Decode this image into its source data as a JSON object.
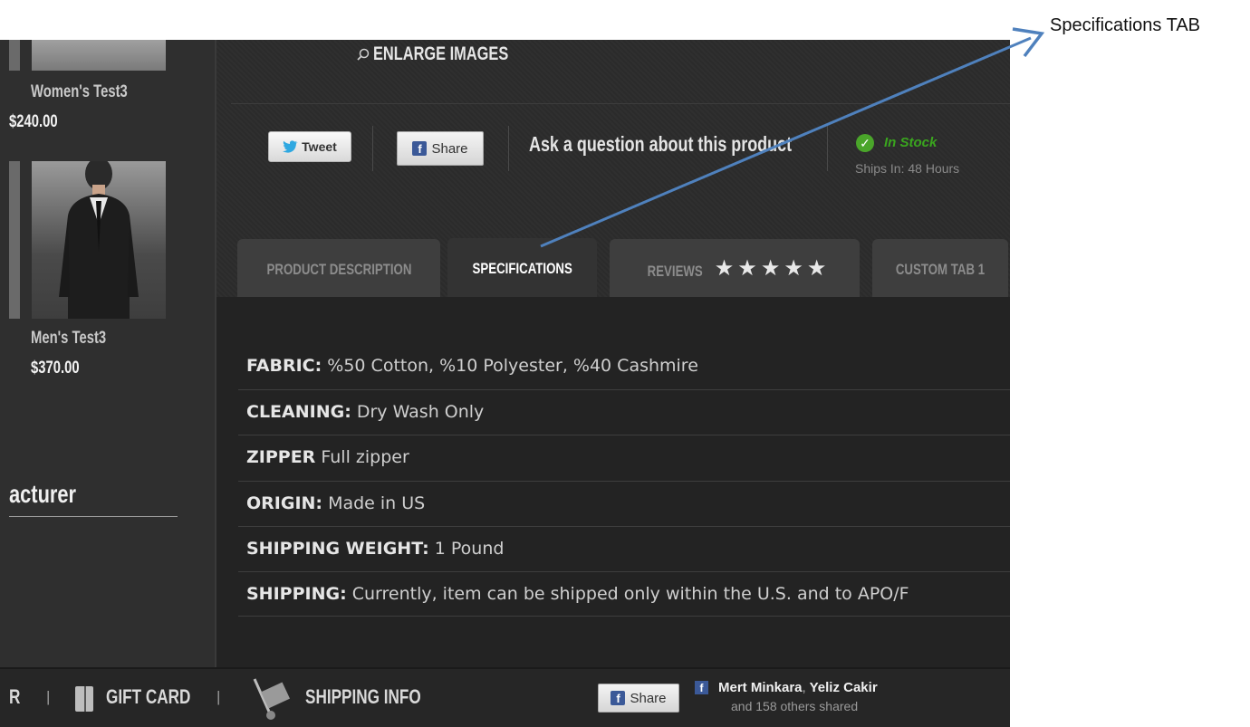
{
  "annotation": {
    "label": "Specifications TAB",
    "arrow_color": "#4f81bd"
  },
  "sidebar": {
    "products": [
      {
        "name": "Women's Test3",
        "price": "$240.00"
      },
      {
        "name": "Men's Test3",
        "price": "$370.00"
      }
    ],
    "manufacturer_heading": "acturer"
  },
  "product": {
    "enlarge_label": "ENLARGE IMAGES",
    "tweet_label": "Tweet",
    "share_label": "Share",
    "ask_label": "Ask a question about this product",
    "stock_status": "In Stock",
    "ships_in": "Ships In: 48 Hours"
  },
  "tabs": [
    {
      "label": "PRODUCT DESCRIPTION",
      "active": false
    },
    {
      "label": "SPECIFICATIONS",
      "active": true
    },
    {
      "label": "REVIEWS",
      "stars": "★★★★★",
      "rating": 5,
      "active": false
    },
    {
      "label": "CUSTOM TAB 1",
      "active": false
    }
  ],
  "specs": [
    {
      "key": "FABRIC:",
      "value": "%50 Cotton, %10 Polyester, %40 Cashmire"
    },
    {
      "key": "CLEANING:",
      "value": "Dry Wash Only"
    },
    {
      "key": "ZIPPER",
      "value": "Full zipper"
    },
    {
      "key": "ORIGIN:",
      "value": "Made in US"
    },
    {
      "key": "SHIPPING WEIGHT:",
      "value": "1 Pound"
    },
    {
      "key": "SHIPPING:",
      "value": "Currently, item can be shipped only within the U.S. and to APO/F"
    }
  ],
  "footer": {
    "partial_label": "R",
    "separator": "|",
    "gift_card": "GIFT CARD",
    "shipping_info": "SHIPPING INFO",
    "share_label": "Share",
    "shared_by": [
      "Mert Minkara",
      "Yeliz Cakir"
    ],
    "shared_comma": ",",
    "shared_count": "and 158 others shared"
  },
  "colors": {
    "in_stock": "#3aa61e",
    "facebook": "#3b5998",
    "background": "#2b2b2b"
  }
}
